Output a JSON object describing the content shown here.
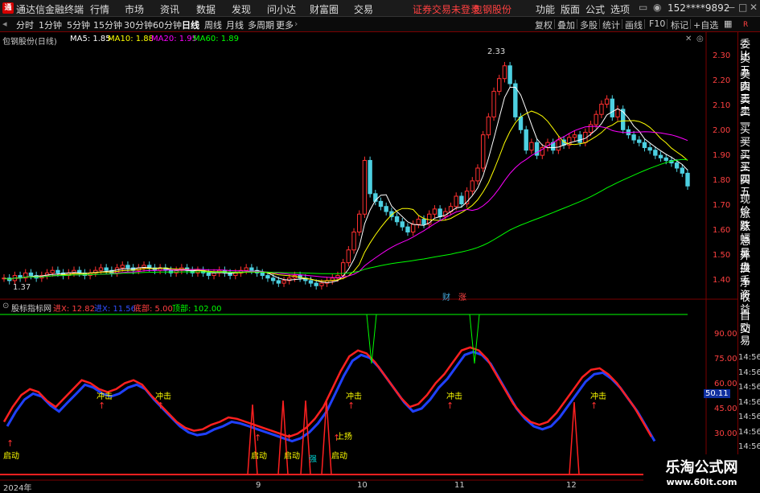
{
  "app": {
    "name": "通达信金融终端",
    "menus": [
      "行情",
      "市场",
      "资讯",
      "数据",
      "发现",
      "问小达",
      "财富圈",
      "交易"
    ],
    "notice": "证券交易未登录",
    "stock_title": "包钢股份",
    "right_menus": [
      "功能",
      "版面",
      "公式",
      "选项"
    ],
    "user": "152****9892"
  },
  "toolbar": {
    "periods": [
      "分时",
      "1分钟",
      "5分钟",
      "15分钟",
      "30分钟",
      "60分钟",
      "日线",
      "周线",
      "月线",
      "多周期",
      "更多"
    ],
    "active_period": "日线",
    "right_buttons": [
      "复权",
      "叠加",
      "多股",
      "统计",
      "画线",
      "F10",
      "标记"
    ],
    "add_watch": "+自选"
  },
  "main_chart": {
    "title": "包钢股份(日线)",
    "ma": [
      {
        "label": "MA5: 1.85",
        "color": "#ffffff"
      },
      {
        "label": "MA10: 1.88",
        "color": "#ffff00"
      },
      {
        "label": "MA20: 1.95",
        "color": "#ff00ff"
      },
      {
        "label": "MA60: 1.89",
        "color": "#00ff00"
      }
    ],
    "y_ticks": [
      "2.30",
      "2.20",
      "2.10",
      "2.00",
      "1.90",
      "1.80",
      "1.70",
      "1.60",
      "1.50",
      "1.40"
    ],
    "high_label": "2.33",
    "low_label": "1.37",
    "flags": [
      "财",
      "涨"
    ]
  },
  "indicator": {
    "name": "股标指标网",
    "params": [
      {
        "label": "进X: 12.82",
        "color": "#ff4040"
      },
      {
        "label": "进X: 11.56",
        "color": "#3050ff"
      },
      {
        "label": "底部: 5.00",
        "color": "#ff4040"
      },
      {
        "label": "顶部: 102.00",
        "color": "#00ff00"
      }
    ],
    "y_ticks": [
      "90.00",
      "75.00",
      "60.00",
      "45.00",
      "30.00"
    ],
    "current": "50.11",
    "signals": {
      "chongji": "冲击",
      "qidong": "启动",
      "shangyang": "上扬",
      "qiang": "强"
    }
  },
  "side_panel": {
    "top_red": "R",
    "items": [
      "委比",
      "卖五",
      "卖四",
      "卖三",
      "卖二",
      "卖一",
      "买一",
      "买二",
      "买三",
      "买四",
      "买五",
      "现价",
      "涨跌",
      "涨幅",
      "总量",
      "外盘",
      "换手",
      "净资",
      "收益",
      "自动",
      "交易"
    ],
    "times": [
      "14:56",
      "14:56",
      "14:56",
      "14:56",
      "14:56",
      "14:56",
      "14:56",
      "14:56",
      "14:56"
    ]
  },
  "x_axis": {
    "labels": [
      "2024年",
      "9",
      "10",
      "11",
      "12"
    ]
  },
  "watermark": {
    "line1": "乐淘公式网",
    "line2": "www.60lt.com"
  },
  "chart_data": {
    "type": "candlestick",
    "title": "包钢股份(日线)",
    "ylim": [
      1.37,
      2.33
    ],
    "close": [
      1.42,
      1.41,
      1.43,
      1.42,
      1.44,
      1.43,
      1.42,
      1.43,
      1.44,
      1.45,
      1.44,
      1.43,
      1.44,
      1.45,
      1.44,
      1.43,
      1.44,
      1.45,
      1.46,
      1.45,
      1.44,
      1.46,
      1.47,
      1.46,
      1.45,
      1.46,
      1.47,
      1.46,
      1.45,
      1.46,
      1.45,
      1.44,
      1.45,
      1.46,
      1.45,
      1.44,
      1.45,
      1.44,
      1.43,
      1.44,
      1.45,
      1.44,
      1.43,
      1.44,
      1.45,
      1.46,
      1.45,
      1.44,
      1.43,
      1.42,
      1.41,
      1.4,
      1.41,
      1.42,
      1.43,
      1.42,
      1.41,
      1.4,
      1.39,
      1.4,
      1.41,
      1.42,
      1.43,
      1.48,
      1.53,
      1.6,
      1.67,
      1.88,
      1.75,
      1.72,
      1.7,
      1.68,
      1.66,
      1.64,
      1.62,
      1.6,
      1.63,
      1.65,
      1.63,
      1.67,
      1.69,
      1.66,
      1.68,
      1.7,
      1.74,
      1.71,
      1.76,
      1.8,
      1.85,
      1.98,
      2.05,
      2.15,
      2.2,
      2.25,
      2.18,
      2.05,
      2.0,
      1.92,
      1.95,
      1.9,
      1.93,
      1.95,
      1.92,
      1.96,
      1.94,
      1.97,
      1.98,
      1.95,
      1.99,
      2.02,
      2.06,
      2.1,
      2.12,
      2.05,
      2.08,
      2.0,
      1.98,
      1.96,
      1.95,
      1.93,
      1.92,
      1.9,
      1.89,
      1.88,
      1.87,
      1.85,
      1.83,
      1.78
    ],
    "indicator_red": [
      30,
      40,
      48,
      52,
      50,
      44,
      40,
      46,
      52,
      58,
      56,
      52,
      50,
      52,
      56,
      58,
      55,
      48,
      42,
      36,
      30,
      26,
      24,
      25,
      28,
      30,
      33,
      32,
      30,
      28,
      26,
      24,
      22,
      20,
      22,
      26,
      32,
      40,
      52,
      64,
      74,
      78,
      76,
      70,
      62,
      54,
      46,
      40,
      42,
      48,
      56,
      62,
      70,
      78,
      80,
      78,
      72,
      62,
      52,
      42,
      35,
      30,
      28,
      30,
      36,
      44,
      52,
      60,
      65,
      66,
      62,
      56,
      48,
      40,
      30,
      20
    ]
  }
}
